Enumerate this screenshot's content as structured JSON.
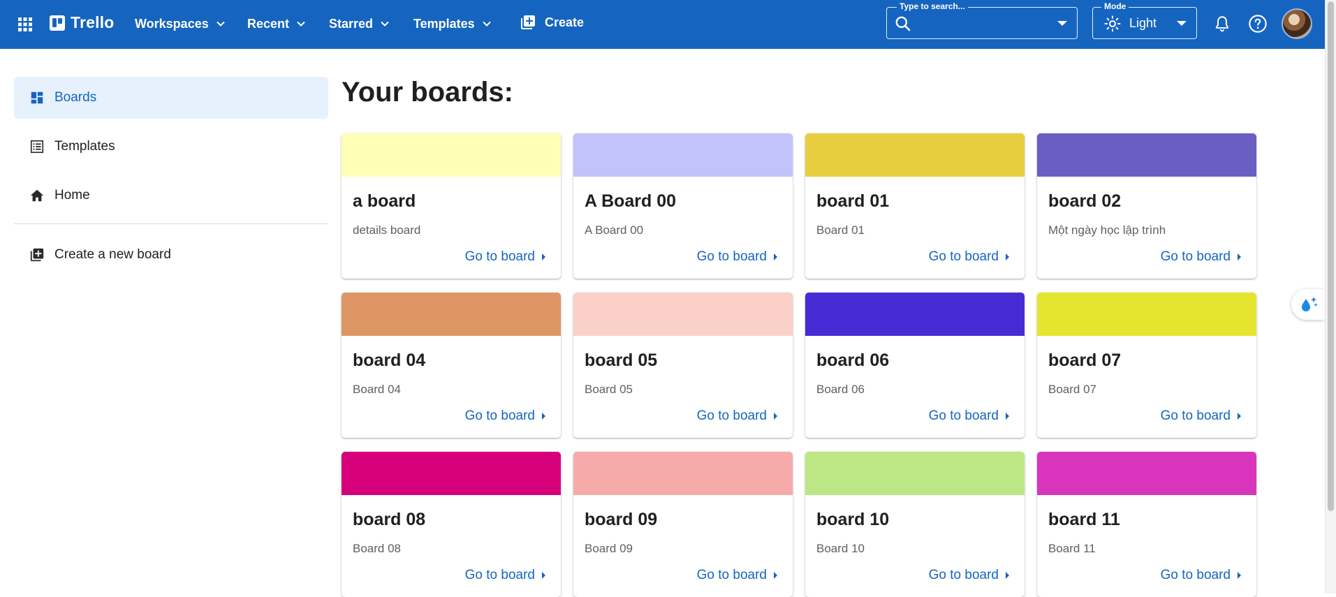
{
  "topbar": {
    "brand": "Trello",
    "nav": [
      {
        "label": "Workspaces"
      },
      {
        "label": "Recent"
      },
      {
        "label": "Starred"
      },
      {
        "label": "Templates"
      }
    ],
    "create_label": "Create",
    "search": {
      "legend": "Type to search...",
      "value": "",
      "placeholder": ""
    },
    "mode": {
      "legend": "Mode",
      "value": "Light"
    }
  },
  "sidebar": {
    "items": [
      {
        "label": "Boards",
        "icon": "dashboard-icon",
        "active": true
      },
      {
        "label": "Templates",
        "icon": "list-icon",
        "active": false
      },
      {
        "label": "Home",
        "icon": "home-icon",
        "active": false
      }
    ],
    "create_label": "Create a new board"
  },
  "main": {
    "title": "Your boards:",
    "go_label": "Go to board",
    "boards": [
      {
        "title": "a board",
        "description": "details board",
        "color": "#fefeb6"
      },
      {
        "title": "A Board 00",
        "description": "A Board 00",
        "color": "#c2c3fb"
      },
      {
        "title": "board 01",
        "description": "Board 01",
        "color": "#e8cd3f"
      },
      {
        "title": "board 02",
        "description": "Một ngày học lập trình",
        "color": "#6a5ec2"
      },
      {
        "title": "board 04",
        "description": "Board 04",
        "color": "#dd9663"
      },
      {
        "title": "board 05",
        "description": "Board 05",
        "color": "#fbd0c6"
      },
      {
        "title": "board 06",
        "description": "Board 06",
        "color": "#472bd4"
      },
      {
        "title": "board 07",
        "description": "Board 07",
        "color": "#e4e52f"
      },
      {
        "title": "board 08",
        "description": "Board 08",
        "color": "#d6017a"
      },
      {
        "title": "board 09",
        "description": "Board 09",
        "color": "#f6abaa"
      },
      {
        "title": "board 10",
        "description": "Board 10",
        "color": "#bce784"
      },
      {
        "title": "board 11",
        "description": "Board 11",
        "color": "#d835bc"
      }
    ]
  },
  "colors": {
    "topbar": "#1565c0",
    "accent": "#1565c0",
    "active_bg": "#e6f1fd"
  }
}
